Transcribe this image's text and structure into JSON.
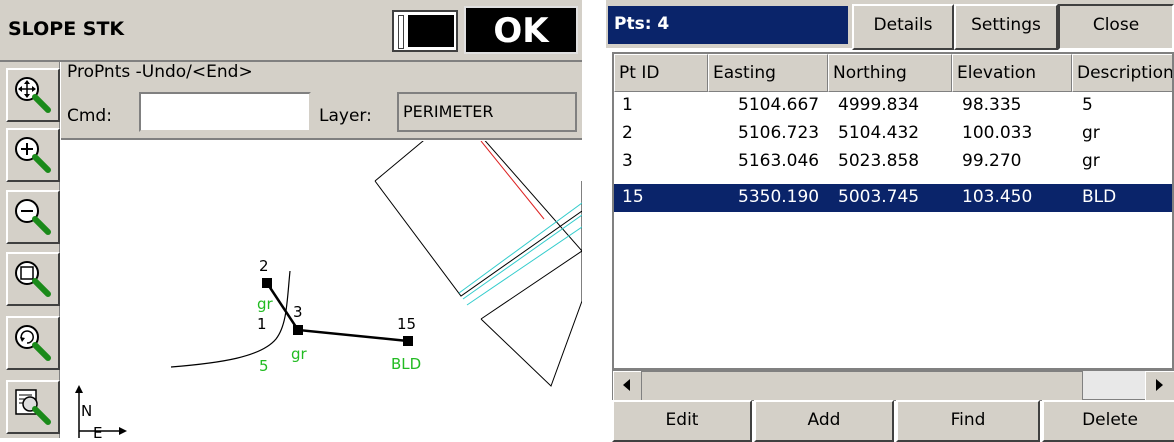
{
  "left": {
    "title": "SLOPE STK",
    "ok_label": "OK",
    "prompt": "ProPnts -Undo/<End>",
    "cmd_label": "Cmd:",
    "cmd_value": "",
    "layer_label": "Layer:",
    "layer_value": "PERIMETER",
    "toolbar": [
      "zoom-extents-icon",
      "zoom-in-icon",
      "zoom-out-icon",
      "zoom-window-icon",
      "zoom-previous-icon",
      "map-settings-icon"
    ],
    "map": {
      "points": [
        {
          "id": "2",
          "desc": "gr",
          "note": "1"
        },
        {
          "id": "3",
          "desc": "gr"
        },
        {
          "id": "15",
          "desc": "BLD"
        }
      ],
      "line_label": "5",
      "north_label": "N",
      "east_label": "E"
    }
  },
  "right": {
    "pts_label": "Pts: 4",
    "details_label": "Details",
    "settings_label": "Settings",
    "close_label": "Close",
    "columns": [
      "Pt ID",
      "Easting",
      "Northing",
      "Elevation",
      "Description"
    ],
    "rows": [
      {
        "id": "1",
        "easting": "5104.667",
        "northing": "4999.834",
        "elevation": "98.335",
        "desc": "5",
        "selected": false
      },
      {
        "id": "2",
        "easting": "5106.723",
        "northing": "5104.432",
        "elevation": "100.033",
        "desc": "gr",
        "selected": false
      },
      {
        "id": "3",
        "easting": "5163.046",
        "northing": "5023.858",
        "elevation": "99.270",
        "desc": "gr",
        "selected": false
      },
      {
        "id": "15",
        "easting": "5350.190",
        "northing": "5003.745",
        "elevation": "103.450",
        "desc": "BLD",
        "selected": true
      }
    ],
    "buttons": [
      "Edit",
      "Add",
      "Find",
      "Delete"
    ]
  },
  "colors": {
    "selection": "#0a246a",
    "label_green": "#22bb22",
    "cyan_line": "#33cccc",
    "red_line": "#dd2222"
  }
}
